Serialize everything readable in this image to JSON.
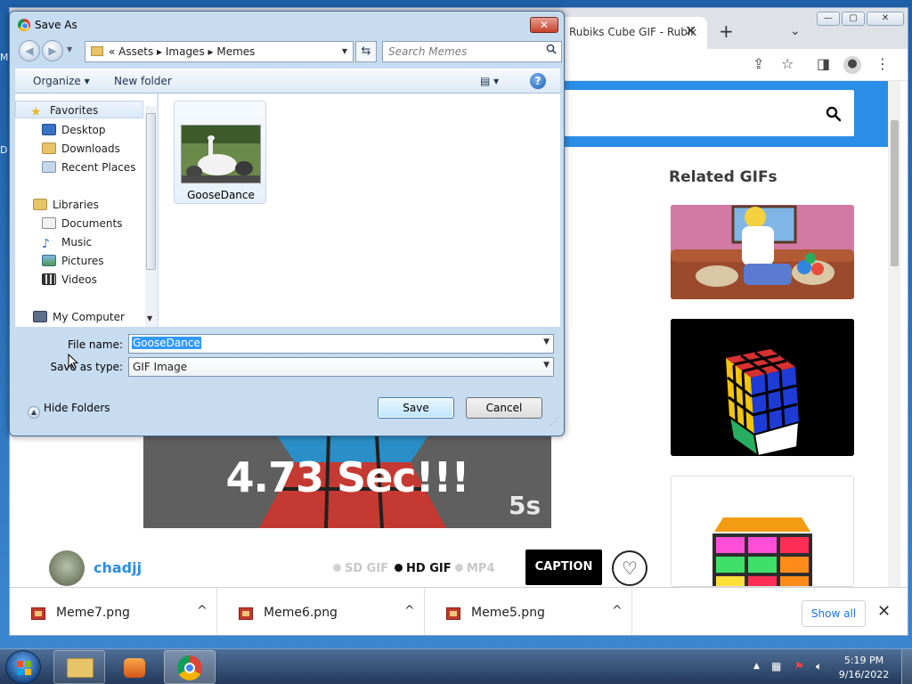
{
  "desktop": {
    "edge_glyphs": [
      "M",
      "D"
    ]
  },
  "chrome": {
    "tab_title": "Rubiks Cube GIF - Rubik",
    "tab_close": "✕",
    "new_tab": "+",
    "tab_menu": "⌄",
    "window_controls": {
      "minimize": "—",
      "maximize": "▢",
      "close": "✕"
    }
  },
  "page": {
    "related_title": "Related GIFs",
    "gif_caption": "4.73 Sec!!!",
    "gif_badge": "5s",
    "username": "chadjj",
    "quality": {
      "sd": "SD GIF",
      "hd": "HD GIF",
      "mp4": "MP4",
      "selected": "hd"
    },
    "caption_button": "CAPTION",
    "heart": "♡"
  },
  "downloads": {
    "items": [
      {
        "name": "Meme7.png"
      },
      {
        "name": "Meme6.png"
      },
      {
        "name": "Meme5.png"
      }
    ],
    "caret": "^",
    "show_all": "Show all",
    "close": "✕"
  },
  "dialog": {
    "title": "Save As",
    "close": "✕",
    "breadcrumb": "«  Assets  ▸  Images  ▸  Memes",
    "search_placeholder": "Search Memes",
    "organize": "Organize ▾",
    "new_folder": "New folder",
    "view": "▤ ▾",
    "help": "?",
    "nav": {
      "favorites": "Favorites",
      "desktop": "Desktop",
      "downloads": "Downloads",
      "recent_places": "Recent Places",
      "libraries": "Libraries",
      "documents": "Documents",
      "music": "Music",
      "pictures": "Pictures",
      "videos": "Videos",
      "my_computer": "My Computer"
    },
    "file": {
      "name": "GooseDance"
    },
    "file_name_label": "File name:",
    "file_name_value": "GooseDance",
    "save_type_label": "Save as type:",
    "save_type_value": "GIF Image",
    "hide_folders": "Hide Folders",
    "save": "Save",
    "cancel": "Cancel"
  },
  "taskbar": {
    "time": "5:19 PM",
    "date": "9/16/2022"
  },
  "colors": {
    "accent": "#2b8ee6",
    "link": "#1a73e8"
  }
}
